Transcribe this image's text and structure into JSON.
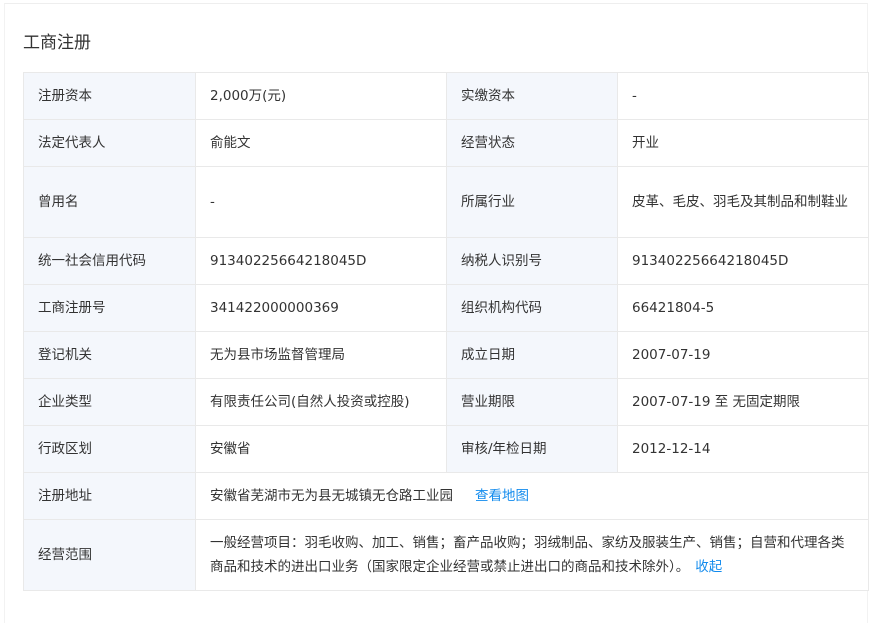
{
  "section": {
    "title": "工商注册"
  },
  "rows": [
    {
      "label1": "注册资本",
      "value1": "2,000万(元)",
      "label2": "实缴资本",
      "value2": "-"
    },
    {
      "label1": "法定代表人",
      "value1": "俞能文",
      "label2": "经营状态",
      "value2": "开业"
    },
    {
      "label1": "曾用名",
      "value1": "-",
      "label2": "所属行业",
      "value2": "皮革、毛皮、羽毛及其制品和制鞋业"
    },
    {
      "label1": "统一社会信用代码",
      "value1": "91340225664218045D",
      "label2": "纳税人识别号",
      "value2": "91340225664218045D"
    },
    {
      "label1": "工商注册号",
      "value1": "341422000000369",
      "label2": "组织机构代码",
      "value2": "66421804-5"
    },
    {
      "label1": "登记机关",
      "value1": "无为县市场监督管理局",
      "label2": "成立日期",
      "value2": "2007-07-19"
    },
    {
      "label1": "企业类型",
      "value1": "有限责任公司(自然人投资或控股)",
      "label2": "营业期限",
      "value2": "2007-07-19 至 无固定期限"
    },
    {
      "label1": "行政区划",
      "value1": "安徽省",
      "label2": "审核/年检日期",
      "value2": "2012-12-14"
    }
  ],
  "address": {
    "label": "注册地址",
    "value": "安徽省芜湖市无为县无城镇无仓路工业园",
    "map_link": "查看地图"
  },
  "scope": {
    "label": "经营范围",
    "value": "一般经营项目：羽毛收购、加工、销售；畜产品收购；羽绒制品、家纺及服装生产、销售；自营和代理各类商品和技术的进出口业务（国家限定企业经营或禁止进出口的商品和技术除外）。",
    "collapse_link": "收起"
  },
  "colors": {
    "label_bg": "#f4f7fc",
    "border": "#e9e9e9",
    "link": "#128bed"
  }
}
